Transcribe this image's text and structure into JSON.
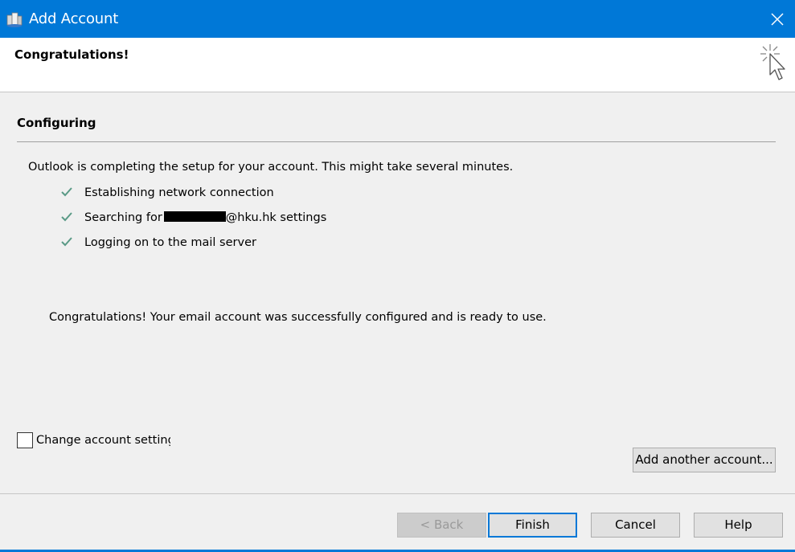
{
  "window": {
    "title": "Add Account",
    "header_heading": "Congratulations!"
  },
  "main": {
    "section_title": "Configuring",
    "description": "Outlook is completing the setup for your account. This might take several minutes.",
    "steps": [
      {
        "label": "Establishing network connection",
        "status": "done"
      },
      {
        "label_prefix": "Searching for",
        "label_suffix": "@hku.hk settings",
        "status": "done"
      },
      {
        "label": "Logging on to the mail server",
        "status": "done"
      }
    ],
    "congrats_message": "Congratulations! Your email account was successfully configured and is ready to use."
  },
  "options": {
    "change_settings_label": "Change account settings",
    "change_settings_checked": false,
    "add_another_label": "Add another account..."
  },
  "buttons": {
    "back": "< Back",
    "finish": "Finish",
    "cancel": "Cancel",
    "help": "Help"
  },
  "colors": {
    "titlebar": "#0078d7",
    "check": "#5a9a86"
  }
}
